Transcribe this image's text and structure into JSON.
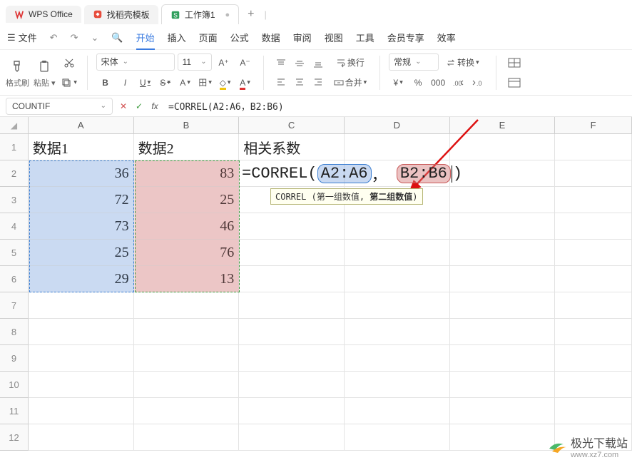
{
  "titlebar": {
    "app_name": "WPS Office",
    "template_tab": "找稻壳模板",
    "workbook_tab": "工作簿1",
    "new_tab_glyph": "+",
    "divider": "|"
  },
  "menubar": {
    "hamburger": "☰",
    "file": "文件",
    "items": [
      "开始",
      "插入",
      "页面",
      "公式",
      "数据",
      "审阅",
      "视图",
      "工具",
      "会员专享",
      "效率"
    ],
    "active_index": 0,
    "undo": "↶",
    "redo": "↷",
    "dropdown_arrow": "⌄",
    "search": "🔍"
  },
  "toolbar": {
    "format_painter": "格式刷",
    "paste": "粘贴",
    "font_name": "宋体",
    "font_size": "11",
    "inc_font": "A⁺",
    "dec_font": "A⁻",
    "bold": "B",
    "italic": "I",
    "underline": "U",
    "strike": "S",
    "font_a": "A",
    "border": "田",
    "fill": "◇",
    "fontcolor": "A",
    "wrap": "换行",
    "merge": "合并",
    "general": "常规",
    "convert": "转换",
    "currency": "¥",
    "percent": "%",
    "comma": "000",
    "dec_inc": ".0→",
    "dec_dec": "←.0"
  },
  "formulabar": {
    "name": "COUNTIF",
    "cancel": "✕",
    "confirm": "✓",
    "fx": "fx",
    "formula": "=CORREL(A2:A6，B2:B6)"
  },
  "grid": {
    "col_headers": [
      "A",
      "B",
      "C",
      "D",
      "E",
      "F"
    ],
    "row_headers": [
      "1",
      "2",
      "3",
      "4",
      "5",
      "6",
      "7",
      "8",
      "9",
      "10",
      "11",
      "12"
    ],
    "header_labels": {
      "A1": "数据1",
      "B1": "数据2",
      "C1": "相关系数"
    },
    "data": {
      "A": [
        36,
        72,
        73,
        25,
        29
      ],
      "B": [
        83,
        25,
        46,
        76,
        13
      ]
    },
    "editing_cell": "C2",
    "editing_formula_parts": {
      "prefix": "=CORREL(",
      "range1": "A2:A6",
      "sep": "，",
      "range2": "B2:B6",
      "suffix": ")"
    },
    "tooltip": {
      "fn": "CORREL",
      "open": " (",
      "arg1": "第一组数值",
      "comma": ", ",
      "arg2": "第二组数值",
      "close": ")"
    },
    "select_all_glyph": "◢"
  },
  "watermark": {
    "name": "极光下载站",
    "url": "www.xz7.com"
  },
  "colors": {
    "range_a_fill": "#7aa6dc",
    "range_b_fill": "#d19393",
    "accent": "#3a7be0",
    "arrow": "#d11"
  }
}
